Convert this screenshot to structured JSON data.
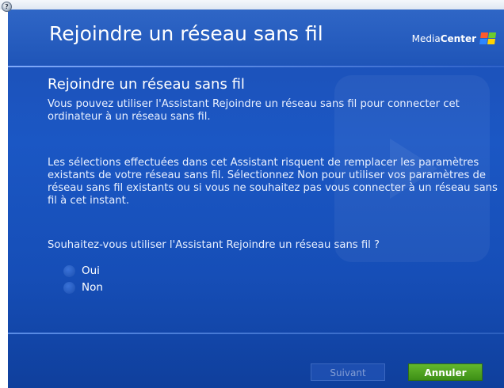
{
  "header": {
    "title": "Rejoindre un réseau sans fil",
    "brand_prefix": "Media",
    "brand_suffix": "Center",
    "help_glyph": "?"
  },
  "content": {
    "subtitle": "Rejoindre un réseau sans fil",
    "paragraph_1": "Vous pouvez utiliser l'Assistant Rejoindre un réseau sans fil pour connecter cet ordinateur à un réseau sans fil.",
    "paragraph_2": "Les sélections effectuées dans cet Assistant risquent de remplacer les paramètres existants de votre réseau sans fil. Sélectionnez Non pour utiliser vos paramètres de réseau sans fil existants ou si vous ne souhaitez pas vous connecter à un réseau sans fil à cet instant.",
    "question": "Souhaitez-vous utiliser l'Assistant Rejoindre un réseau sans fil ?",
    "options": [
      {
        "label": "Oui"
      },
      {
        "label": "Non"
      }
    ]
  },
  "footer": {
    "next_label": "Suivant",
    "cancel_label": "Annuler"
  },
  "icons": {
    "brand": "windows-flag-icon",
    "help": "help-icon",
    "radio": "radio-button-icon"
  },
  "colors": {
    "background": "#1b57c4",
    "header": "#2f66c6",
    "accent_green": "#4fa322",
    "text": "#ffffff"
  }
}
